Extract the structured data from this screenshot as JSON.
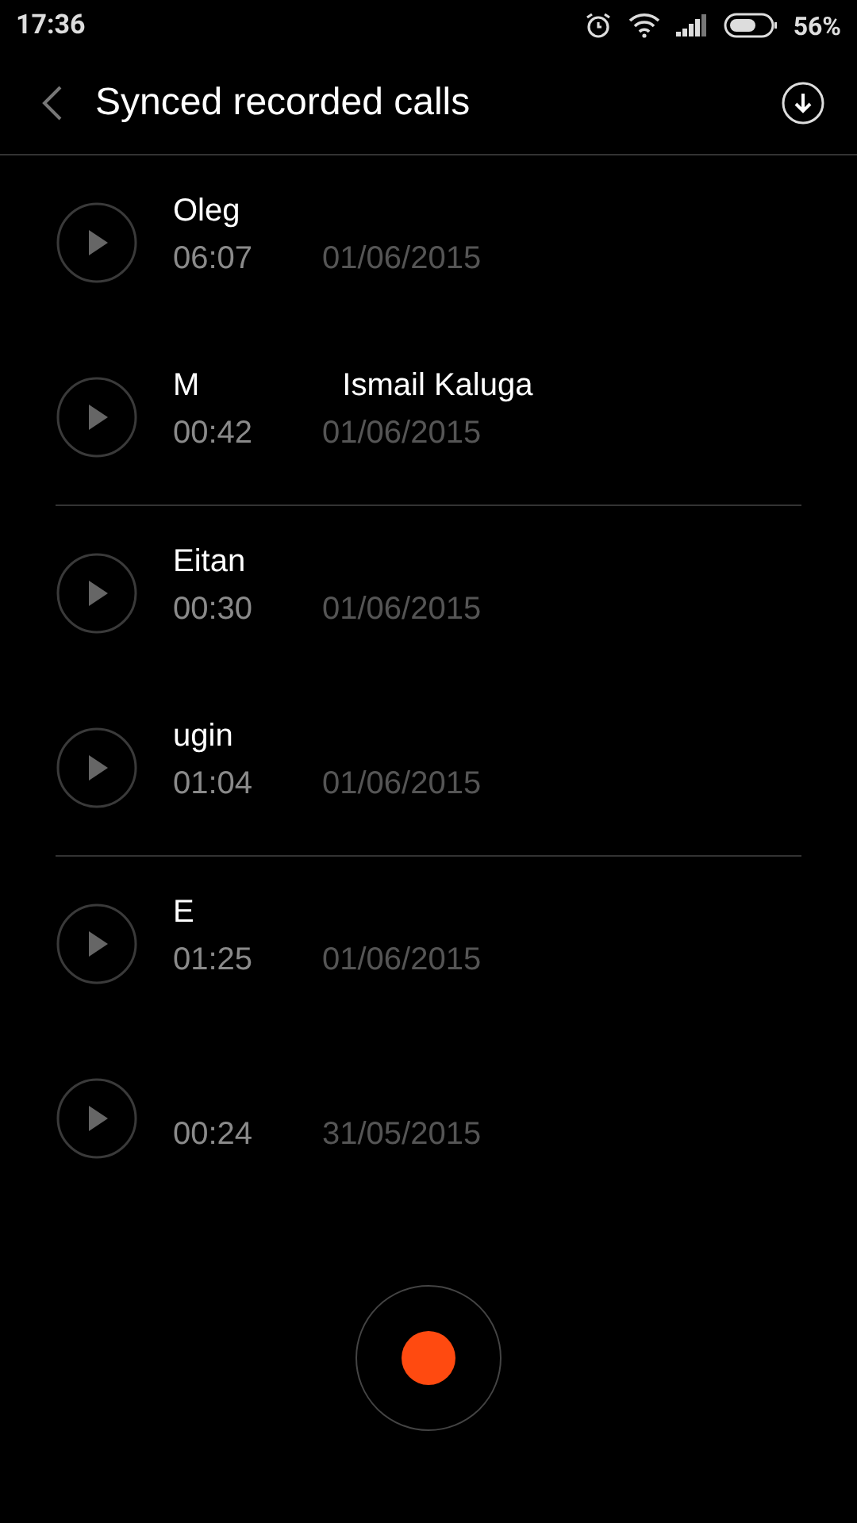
{
  "status_bar": {
    "time": "17:36",
    "battery": "56%"
  },
  "header": {
    "title": "Synced recorded calls"
  },
  "groups": [
    [
      {
        "name_parts": [
          "Oleg"
        ],
        "duration": "06:07",
        "date": "01/06/2015"
      },
      {
        "name_parts": [
          "M",
          "Ismail Kaluga"
        ],
        "duration": "00:42",
        "date": "01/06/2015"
      }
    ],
    [
      {
        "name_parts": [
          "Eitan"
        ],
        "duration": "00:30",
        "date": "01/06/2015"
      },
      {
        "name_parts": [
          "ugin"
        ],
        "duration": "01:04",
        "date": "01/06/2015"
      }
    ],
    [
      {
        "name_parts": [
          "E"
        ],
        "duration": "01:25",
        "date": "01/06/2015"
      },
      {
        "duration": "00:24",
        "date": "31/05/2015"
      }
    ]
  ]
}
